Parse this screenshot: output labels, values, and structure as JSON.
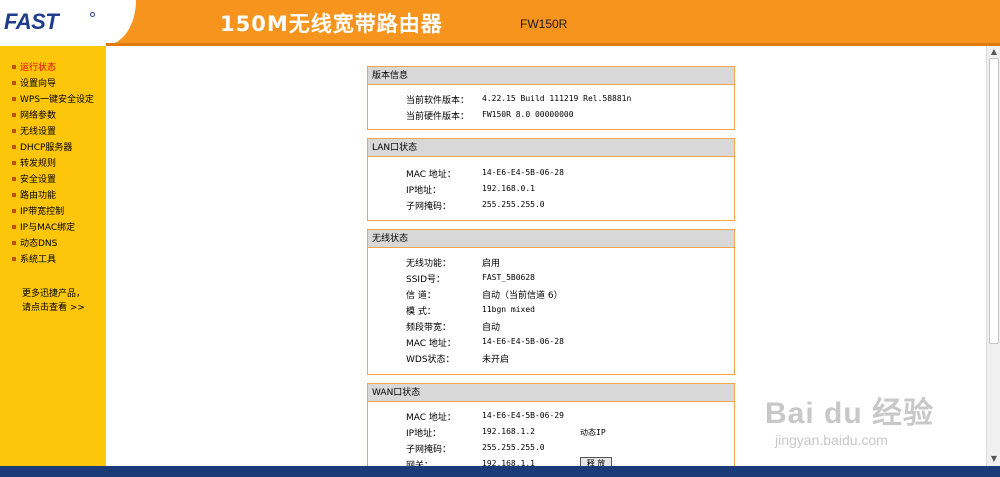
{
  "header": {
    "logo": "FAST",
    "title": "150M无线宽带路由器",
    "model": "FW150R"
  },
  "sidebar": {
    "items": [
      {
        "label": "运行状态",
        "active": true
      },
      {
        "label": "设置向导"
      },
      {
        "label": "WPS一键安全设定"
      },
      {
        "label": "网络参数"
      },
      {
        "label": "无线设置"
      },
      {
        "label": "DHCP服务器"
      },
      {
        "label": "转发规则"
      },
      {
        "label": "安全设置"
      },
      {
        "label": "路由功能"
      },
      {
        "label": "IP带宽控制"
      },
      {
        "label": "IP与MAC绑定"
      },
      {
        "label": "动态DNS"
      },
      {
        "label": "系统工具"
      }
    ],
    "more_line1": "更多迅捷产品，",
    "more_line2": "请点击查看 >>"
  },
  "panels": {
    "version": {
      "title": "版本信息",
      "rows": [
        {
          "label": "当前软件版本：",
          "value": "4.22.15 Build 111219 Rel.58881n"
        },
        {
          "label": "当前硬件版本：",
          "value": "FW150R 8.0 00000000"
        }
      ]
    },
    "lan": {
      "title": "LAN口状态",
      "rows": [
        {
          "label": "MAC 地址：",
          "value": "14-E6-E4-5B-06-28"
        },
        {
          "label": "IP地址：",
          "value": "192.168.0.1"
        },
        {
          "label": "子网掩码：",
          "value": "255.255.255.0"
        }
      ]
    },
    "wireless": {
      "title": "无线状态",
      "rows": [
        {
          "label": "无线功能：",
          "value": "启用"
        },
        {
          "label": "SSID号：",
          "value": "FAST_5B0628"
        },
        {
          "label": "信 道：",
          "value": "自动（当前信道 6）"
        },
        {
          "label": "模 式：",
          "value": "11bgn mixed"
        },
        {
          "label": "频段带宽：",
          "value": "自动"
        },
        {
          "label": "MAC 地址：",
          "value": "14-E6-E4-5B-06-28"
        },
        {
          "label": "WDS状态：",
          "value": "未开启"
        }
      ]
    },
    "wan": {
      "title": "WAN口状态",
      "rows": [
        {
          "label": "MAC 地址：",
          "value": "14-E6-E4-5B-06-29"
        },
        {
          "label": "IP地址：",
          "value": "192.168.1.2",
          "extra": "动态IP"
        },
        {
          "label": "子网掩码：",
          "value": "255.255.255.0"
        },
        {
          "label": "网关：",
          "value": "192.168.1.1"
        }
      ],
      "release_label": "释 放"
    }
  },
  "watermark": {
    "logo": "Bai du 经验",
    "url": "jingyan.baidu.com"
  }
}
